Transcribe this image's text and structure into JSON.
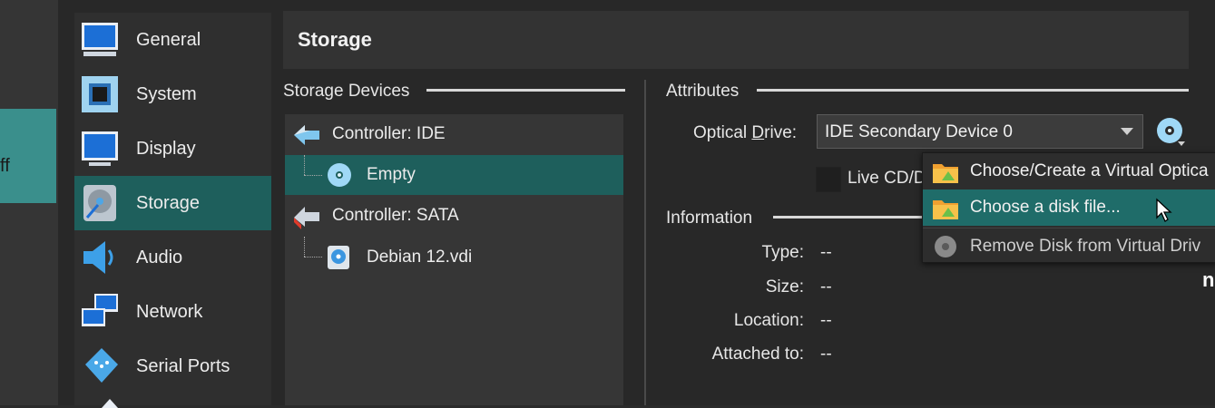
{
  "background": {
    "partial_text": "ff"
  },
  "header": {
    "title": "Storage"
  },
  "sidebar": {
    "items": [
      {
        "label": "General",
        "icon": "monitor-icon"
      },
      {
        "label": "System",
        "icon": "chip-icon"
      },
      {
        "label": "Display",
        "icon": "display-icon"
      },
      {
        "label": "Storage",
        "icon": "hard-disk-icon",
        "selected": true
      },
      {
        "label": "Audio",
        "icon": "speaker-icon"
      },
      {
        "label": "Network",
        "icon": "network-icon"
      },
      {
        "label": "Serial Ports",
        "icon": "serial-port-icon"
      }
    ]
  },
  "storage_devices": {
    "title": "Storage Devices",
    "tree": [
      {
        "label": "Controller: IDE",
        "type": "controller"
      },
      {
        "label": "Empty",
        "type": "optical",
        "selected": true
      },
      {
        "label": "Controller: SATA",
        "type": "controller"
      },
      {
        "label": "Debian 12.vdi",
        "type": "disk"
      }
    ]
  },
  "attributes": {
    "title": "Attributes",
    "optical_drive_label_pre": "Optical ",
    "optical_drive_label_u": "D",
    "optical_drive_label_post": "rive:",
    "optical_drive_value": "IDE Secondary Device 0",
    "live_cd_label": "Live CD/D"
  },
  "information": {
    "title": "Information",
    "rows": [
      {
        "label": "Type:",
        "value": "--"
      },
      {
        "label": "Size:",
        "value": "--"
      },
      {
        "label": "Location:",
        "value": "--"
      },
      {
        "label": "Attached to:",
        "value": "--"
      }
    ]
  },
  "menu": {
    "items": [
      {
        "label": "Choose/Create a Virtual Optica",
        "enabled": true
      },
      {
        "label": "Choose a disk file...",
        "enabled": true,
        "highlighted": true
      },
      {
        "label": "Remove Disk from Virtual Driv",
        "enabled": false
      }
    ]
  },
  "right_edge_text": "n",
  "colors": {
    "selection": "#1e5f5c",
    "menu_highlight": "#1f6c69",
    "teal_background": "#3a8f8c"
  }
}
